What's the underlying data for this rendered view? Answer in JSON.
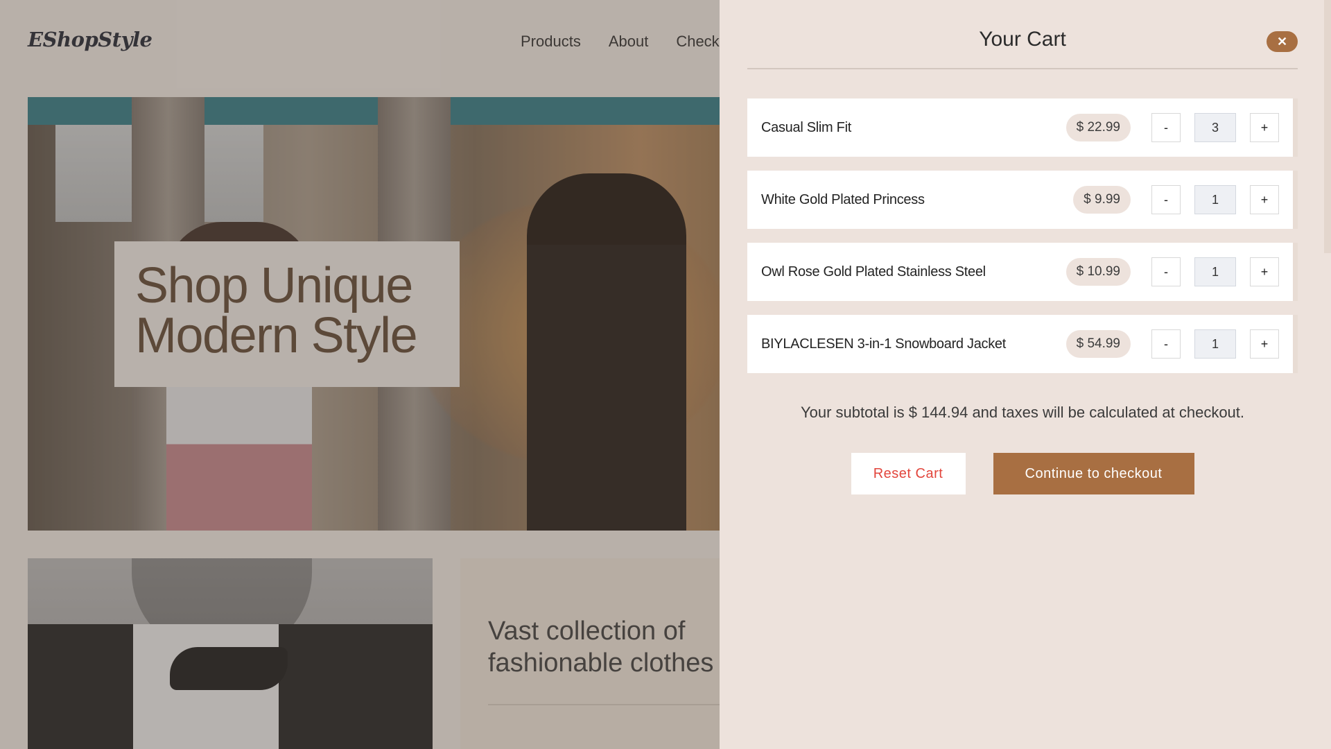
{
  "site": {
    "logo": "EShopStyle",
    "nav": [
      "Products",
      "About",
      "Check"
    ],
    "hero": {
      "title_line1": "Shop Unique",
      "title_line2": "Modern Style"
    },
    "promo": {
      "text": "Vast collection of fashionable clothes"
    }
  },
  "cart": {
    "title": "Your Cart",
    "close_label": "✕",
    "items": [
      {
        "name": "Casual Slim Fit",
        "price": "$ 22.99",
        "qty": "3"
      },
      {
        "name": "White Gold Plated Princess",
        "price": "$ 9.99",
        "qty": "1"
      },
      {
        "name": "Owl Rose Gold Plated Stainless Steel",
        "price": "$ 10.99",
        "qty": "1"
      },
      {
        "name": "BIYLACLESEN 3-in-1 Snowboard Jacket",
        "price": "$ 54.99",
        "qty": "1"
      }
    ],
    "minus_label": "-",
    "plus_label": "+",
    "subtotal_text": "Your subtotal is $ 144.94 and taxes will be calculated at checkout.",
    "reset_label": "Reset Cart",
    "checkout_label": "Continue to checkout"
  },
  "colors": {
    "accent": "#a86f42",
    "drawer_bg": "#ede2dc",
    "reset_text": "#e2453c"
  }
}
